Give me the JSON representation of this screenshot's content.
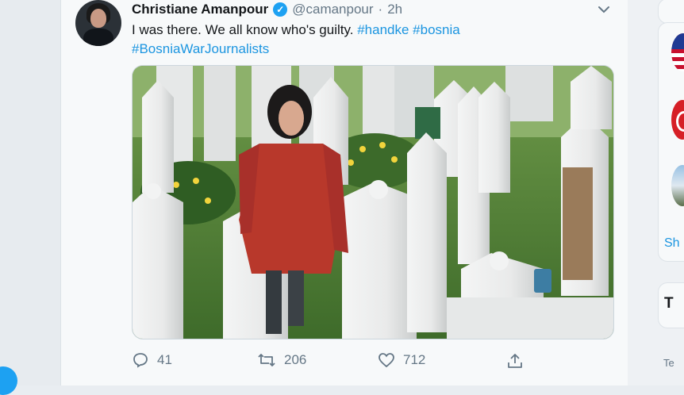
{
  "tweet": {
    "author_name": "Christiane Amanpour",
    "handle": "@camanpour",
    "separator": "·",
    "time": "2h",
    "text_plain": "I was there. We all know who's guilty.",
    "hashtags": [
      "#handke",
      "#bosnia",
      "#BosniaWarJournalists"
    ],
    "verified_glyph": "✓",
    "media_icon": "memorial-photo"
  },
  "actions": {
    "reply_count": "41",
    "retweet_count": "206",
    "like_count": "712"
  },
  "sidebar": {
    "show_link": "Sh",
    "trend_title": "T",
    "terms_link": "Te"
  },
  "colors": {
    "accent": "#1da1f2",
    "link": "#1b95e0",
    "muted": "#657786",
    "jacket": "#b8382b"
  },
  "icons": {
    "verified": "verified-badge-icon",
    "chevron": "chevron-down-icon",
    "reply": "reply-icon",
    "retweet": "retweet-icon",
    "like": "heart-icon",
    "share": "share-icon"
  }
}
